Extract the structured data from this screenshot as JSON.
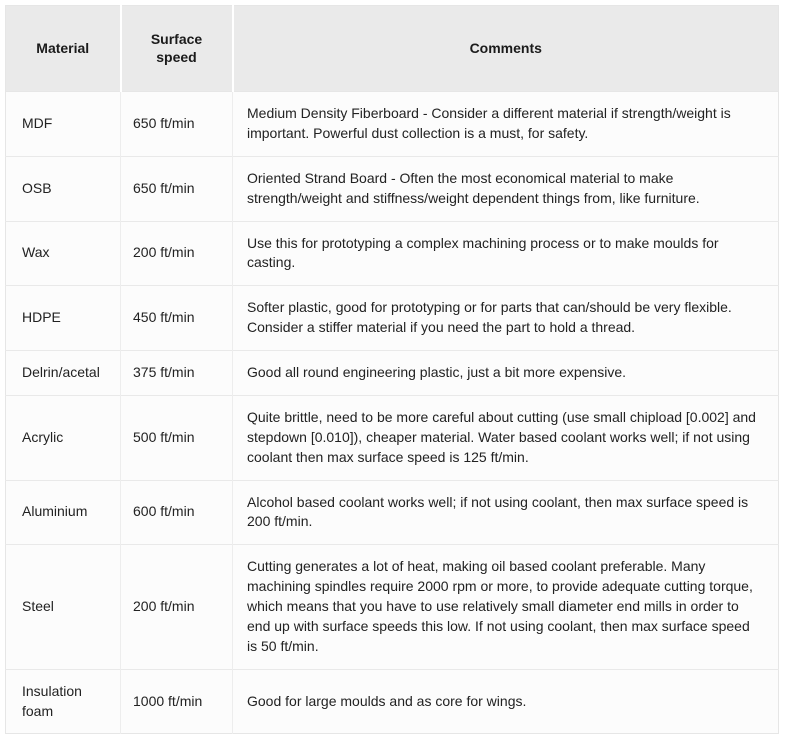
{
  "table": {
    "columns": [
      {
        "key": "material",
        "label": "Material",
        "align": "center"
      },
      {
        "key": "speed",
        "label": "Surface\nspeed",
        "label_line1": "Surface",
        "label_line2": "speed",
        "align": "center"
      },
      {
        "key": "comments",
        "label": "Comments",
        "align": "center"
      }
    ],
    "rows": [
      {
        "material": "MDF",
        "speed": "650 ft/min",
        "comments": "Medium Density Fiberboard - Consider a different material if strength/weight is important. Powerful dust collection is a must, for safety."
      },
      {
        "material": "OSB",
        "speed": "650 ft/min",
        "comments": "Oriented Strand Board - Often the most economical material to make strength/weight and stiffness/weight dependent things from, like furniture."
      },
      {
        "material": "Wax",
        "speed": "200 ft/min",
        "comments": "Use this for prototyping a complex machining process or to make moulds for casting."
      },
      {
        "material": "HDPE",
        "speed": "450 ft/min",
        "comments": "Softer plastic, good for prototyping or for parts that can/should be very flexible. Consider a stiffer material if you need the part to hold a thread."
      },
      {
        "material": "Delrin/acetal",
        "speed": "375 ft/min",
        "comments": "Good all round engineering plastic, just a bit more expensive."
      },
      {
        "material": "Acrylic",
        "speed": "500 ft/min",
        "comments": "Quite brittle, need to be more careful about cutting (use small chipload [0.002] and stepdown [0.010]), cheaper material. Water based coolant works well; if not using coolant then max surface speed is 125 ft/min."
      },
      {
        "material": "Aluminium",
        "speed": "600 ft/min",
        "comments": "Alcohol based coolant works well; if not using coolant, then max surface speed is 200 ft/min."
      },
      {
        "material": "Steel",
        "speed": "200 ft/min",
        "comments": "Cutting generates a lot of heat, making oil based coolant preferable. Many machining spindles require 2000 rpm or more, to provide adequate cutting torque, which means that you have to use relatively small diameter end mills in order to end up with surface speeds this low. If not using coolant, then max surface speed is 50 ft/min."
      },
      {
        "material": "Insulation foam",
        "speed": "1000 ft/min",
        "comments": "Good for large moulds and as core for wings."
      }
    ]
  },
  "style": {
    "header_background": "#eaeaea",
    "cell_background": "#fcfcfc",
    "border_color": "#e6e6e6",
    "text_color": "#222222"
  }
}
